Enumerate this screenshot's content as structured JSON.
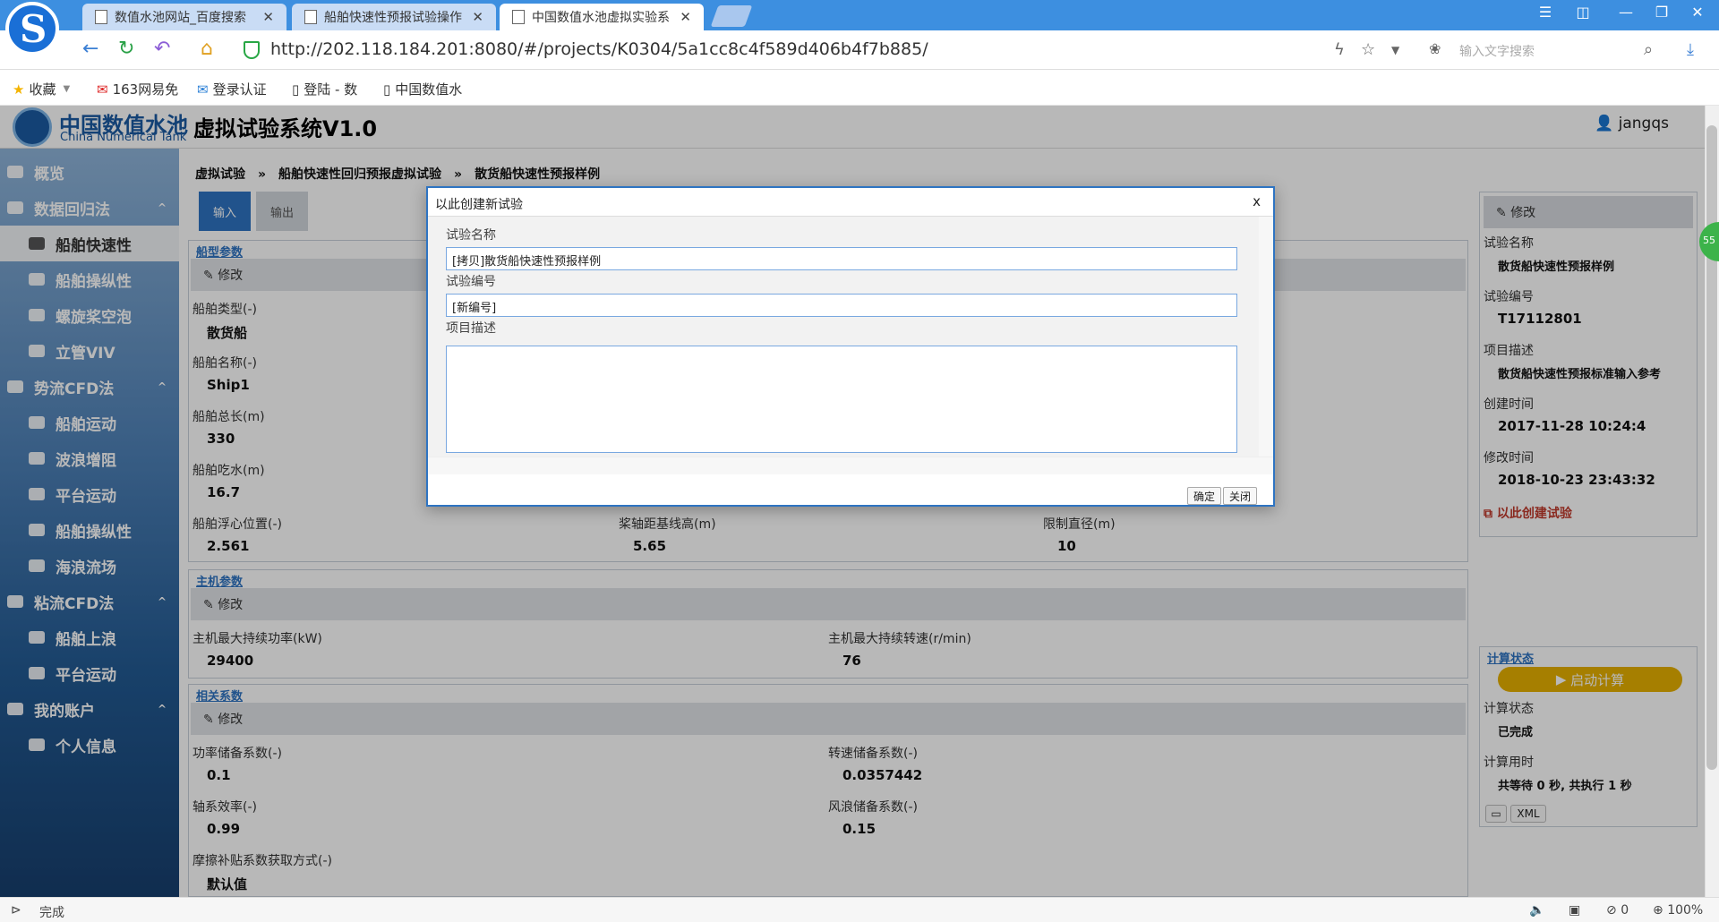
{
  "browser": {
    "tabs": [
      {
        "label": "数值水池网站_百度搜索",
        "active": false
      },
      {
        "label": "船舶快速性预报试验操作",
        "active": false
      },
      {
        "label": "中国数值水池虚拟实验系",
        "active": true
      }
    ],
    "url": "http://202.118.184.201:8080/#/projects/K0304/5a1cc8c4f589d406b4f7b885/",
    "search_placeholder": "输入文字搜索",
    "bookmarks": [
      "收藏",
      "163网易免",
      "登录认证",
      "登陆 - 数",
      "中国数值水"
    ],
    "status_text": "完成",
    "status_count": "0",
    "zoom": "100%"
  },
  "app": {
    "brand_cn": "中国数值水池",
    "brand_en": "China Numerical Tank",
    "title": "虚拟试验系统V1.0",
    "user": "jangqs"
  },
  "sidebar": {
    "items": [
      {
        "label": "概览",
        "type": "group"
      },
      {
        "label": "数据回归法",
        "type": "group",
        "chevron": "^"
      },
      {
        "label": "船舶快速性",
        "type": "sub",
        "active": true
      },
      {
        "label": "船舶操纵性",
        "type": "sub"
      },
      {
        "label": "螺旋桨空泡",
        "type": "sub"
      },
      {
        "label": "立管VIV",
        "type": "sub"
      },
      {
        "label": "势流CFD法",
        "type": "group",
        "chevron": "^"
      },
      {
        "label": "船舶运动",
        "type": "sub"
      },
      {
        "label": "波浪增阻",
        "type": "sub"
      },
      {
        "label": "平台运动",
        "type": "sub"
      },
      {
        "label": "船舶操纵性",
        "type": "sub"
      },
      {
        "label": "海浪流场",
        "type": "sub"
      },
      {
        "label": "粘流CFD法",
        "type": "group",
        "chevron": "^"
      },
      {
        "label": "船舶上浪",
        "type": "sub"
      },
      {
        "label": "平台运动",
        "type": "sub"
      },
      {
        "label": "我的账户",
        "type": "group",
        "chevron": "^"
      },
      {
        "label": "个人信息",
        "type": "sub"
      }
    ]
  },
  "breadcrumb": [
    "虚拟试验",
    "船舶快速性回归预报虚拟试验",
    "散货船快速性预报样例"
  ],
  "main_tabs": {
    "input": "输入",
    "output": "输出"
  },
  "edit_label": "修改",
  "ship_params": {
    "title": "船型参数",
    "fields": [
      {
        "label": "船舶类型(-)",
        "value": "散货船"
      },
      {
        "label": "船舶名称(-)",
        "value": "Ship1"
      },
      {
        "label": "船舶总长(m)",
        "value": "330"
      },
      {
        "label": "船舶吃水(m)",
        "value": "16.7"
      },
      {
        "label": "船舶浮心位置(-)",
        "value": "2.561"
      },
      {
        "label": "桨轴距基线高(m)",
        "value": "5.65"
      },
      {
        "label": "限制直径(m)",
        "value": "10"
      }
    ]
  },
  "engine_params": {
    "title": "主机参数",
    "fields": [
      {
        "label": "主机最大持续功率(kW)",
        "value": "29400"
      },
      {
        "label": "主机最大持续转速(r/min)",
        "value": "76"
      }
    ]
  },
  "coef_params": {
    "title": "相关系数",
    "fields": [
      {
        "label": "功率储备系数(-)",
        "value": "0.1"
      },
      {
        "label": "转速储备系数(-)",
        "value": "0.0357442"
      },
      {
        "label": "轴系效率(-)",
        "value": "0.99"
      },
      {
        "label": "风浪储备系数(-)",
        "value": "0.15"
      },
      {
        "label": "摩擦补贴系数获取方式(-)",
        "value": "默认值"
      }
    ]
  },
  "info_panel": {
    "edit": "修改",
    "fields": [
      {
        "label": "试验名称",
        "value": "散货船快速性预报样例"
      },
      {
        "label": "试验编号",
        "value": "T17112801"
      },
      {
        "label": "项目描述",
        "value": "散货船快速性预报标准输入参考"
      },
      {
        "label": "创建时间",
        "value": "2017-11-28 10:24:4"
      },
      {
        "label": "修改时间",
        "value": "2018-10-23 23:43:32"
      }
    ],
    "create_link": "以此创建试验"
  },
  "calc_panel": {
    "title": "计算状态",
    "start_button": "启动计算",
    "fields": [
      {
        "label": "计算状态",
        "value": "已完成"
      },
      {
        "label": "计算用时",
        "value": "共等待 0 秒, 共执行 1 秒"
      }
    ],
    "xml_button": "XML"
  },
  "side_badge": "55",
  "modal": {
    "title": "以此创建新试验",
    "close": "x",
    "name_label": "试验名称",
    "name_value": "[拷贝]散货船快速性预报样例",
    "code_label": "试验编号",
    "code_value": "[新编号]",
    "desc_label": "项目描述",
    "desc_value": "",
    "ok": "确定",
    "cancel": "关闭"
  }
}
